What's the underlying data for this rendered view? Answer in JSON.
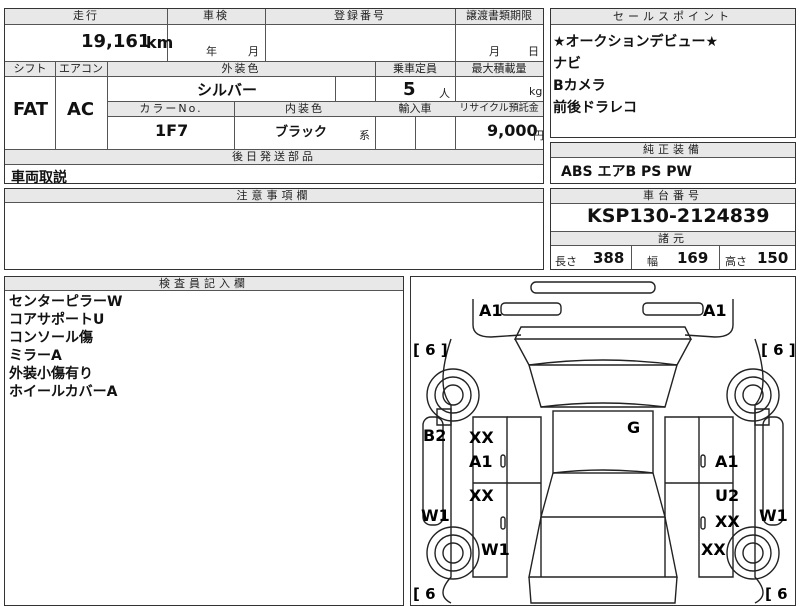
{
  "top_fields": {
    "mileage_label": "走行",
    "mileage_value": "19,161",
    "mileage_unit": "km",
    "inspection_label": "車検",
    "inspection_year_unit": "年",
    "inspection_month_unit": "月",
    "registration_label": "登録番号",
    "transfer_deadline_label": "譲渡書類期限",
    "transfer_month_unit": "月",
    "transfer_day_unit": "日"
  },
  "mid_fields": {
    "shift_label": "シフト",
    "shift_value": "FAT",
    "aircon_label": "エアコン",
    "aircon_value": "AC",
    "exterior_color_label": "外装色",
    "exterior_color_value": "シルバー",
    "capacity_label": "乗車定員",
    "capacity_value": "5",
    "capacity_unit": "人",
    "max_load_label": "最大積載量",
    "max_load_unit": "kg",
    "color_no_label": "カラーNo.",
    "color_no_value": "1F7",
    "interior_color_label": "内装色",
    "interior_color_value": "ブラック",
    "interior_color_suffix": "系",
    "import_label": "輸入車",
    "recycle_label": "リサイクル預託金",
    "recycle_value": "9,000",
    "recycle_unit": "円"
  },
  "later_parts": {
    "label": "後日発送部品",
    "value": "車両取説"
  },
  "notes": {
    "label": "注意事項欄"
  },
  "inspector_notes": {
    "label": "検査員記入欄",
    "lines": [
      "センターピラーW",
      "コアサポートU",
      "コンソール傷",
      "ミラーA",
      "外装小傷有り",
      "ホイールカバーA"
    ]
  },
  "sales_points": {
    "label": "セールスポイント",
    "lines": [
      "★オークションデビュー★",
      "ナビ",
      "Bカメラ",
      "前後ドラレコ"
    ]
  },
  "standard_equipment": {
    "label": "純正装備",
    "value": "ABS エアB PS PW"
  },
  "chassis": {
    "label": "車台番号",
    "value": "KSP130-2124839"
  },
  "dimensions": {
    "label": "諸元",
    "length_label": "長さ",
    "length_value": "388",
    "width_label": "幅",
    "width_value": "169",
    "height_label": "高さ",
    "height_value": "150"
  },
  "diagram": {
    "tire_left_top": "[ 6 ]",
    "tire_right_top": "[ 6 ]",
    "tire_left_bottom": "[ 6",
    "tire_right_bottom": "[ 6",
    "marks": {
      "front_left": "A1",
      "front_right": "A1",
      "left_side": "B2",
      "left_sill": "W1",
      "front_door_l_1": "XX",
      "front_door_l_2": "A1",
      "rear_door_l": "XX",
      "left_rear": "W1",
      "roof": "G",
      "right_front_door": "A1",
      "right_rear_door_1": "U2",
      "right_rear_door_2": "XX",
      "right_sill": "W1",
      "right_rear": "XX"
    }
  }
}
